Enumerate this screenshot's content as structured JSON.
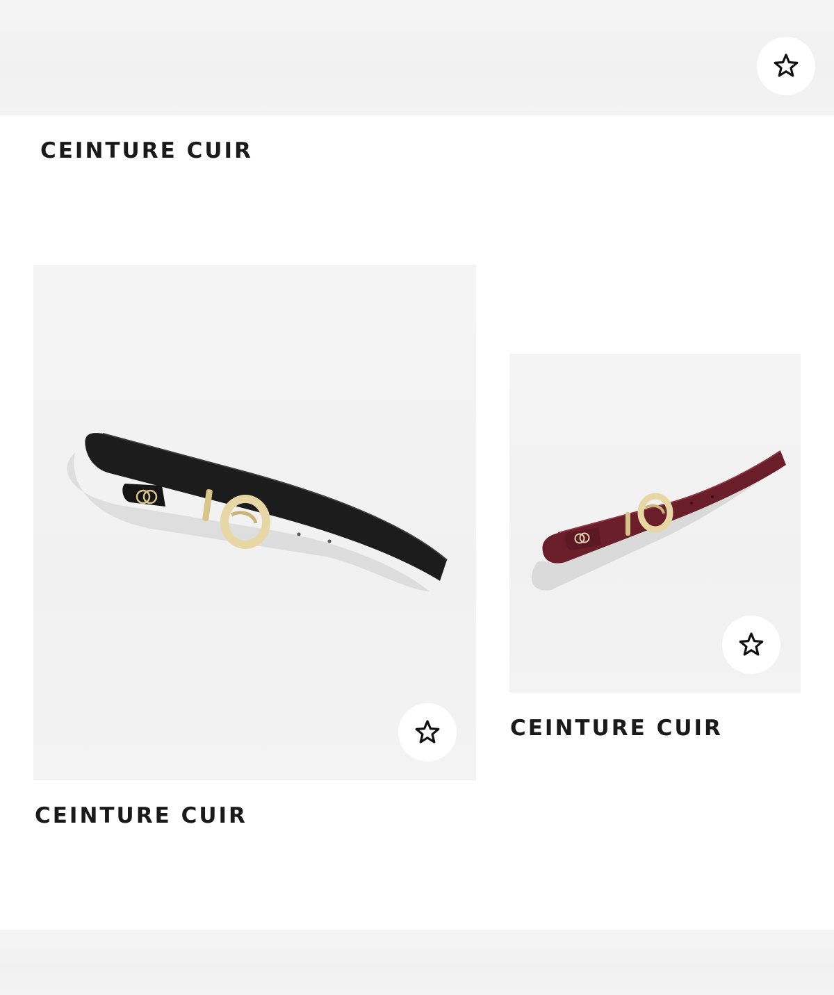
{
  "products": [
    {
      "name": "CEINTURE CUIR",
      "favorite_icon": "star-outline-icon"
    },
    {
      "name": "CEINTURE CUIR",
      "favorite_icon": "star-outline-icon",
      "image_subject": "black leather belt with gold buckle",
      "colors": {
        "leather": "#1c1c1c",
        "buckle": "#d9c48a"
      }
    },
    {
      "name": "CEINTURE CUIR",
      "favorite_icon": "star-outline-icon",
      "image_subject": "burgundy leather belt with gold buckle",
      "colors": {
        "leather": "#6a1e2a",
        "buckle": "#d9c48a"
      }
    }
  ]
}
